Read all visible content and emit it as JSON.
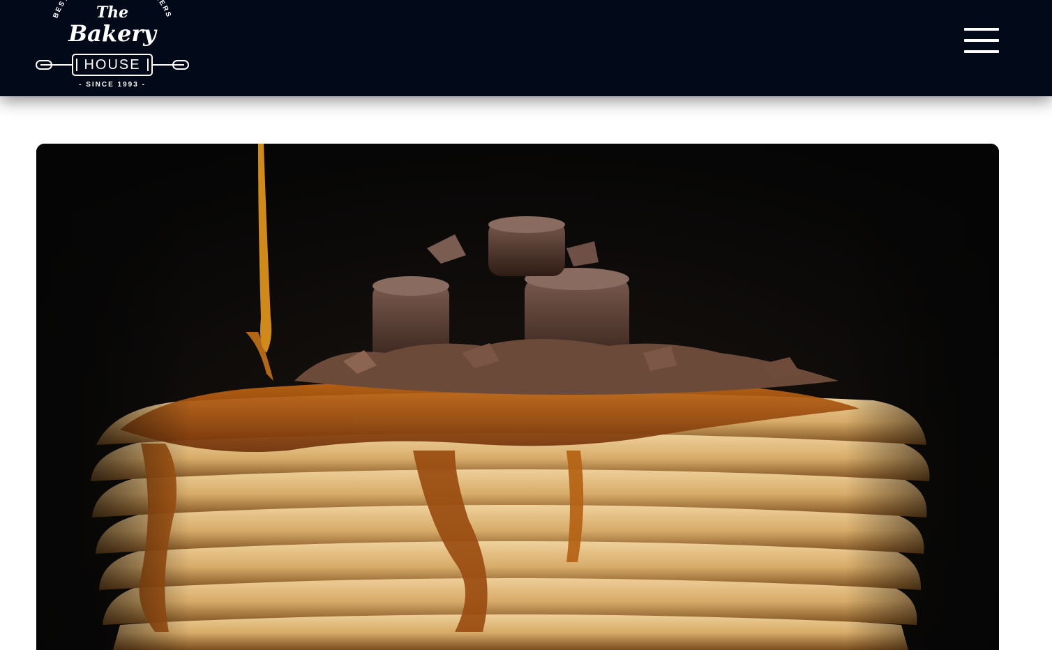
{
  "header": {
    "logo": {
      "arc_text": "BEST QUALITY FAMILY BAKERS",
      "title_small": "The",
      "title_large": "Bakery",
      "banner": "HOUSE",
      "since": "- SINCE 1993 -"
    },
    "menu_icon": "hamburger-icon"
  },
  "colors": {
    "header_bg": "#020a1a",
    "page_bg": "#ffffff",
    "icon": "#ffffff"
  },
  "hero": {
    "image_subject": "pancake-stack-with-syrup-and-chocolate"
  }
}
